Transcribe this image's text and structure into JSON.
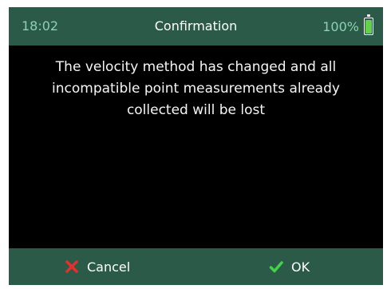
{
  "status": {
    "time": "18:02",
    "title": "Confirmation",
    "battery_percent_text": "100%",
    "battery_level": 1.0
  },
  "message": {
    "text": "The velocity method has changed and all incompatible point measurements already collected will be lost"
  },
  "footer": {
    "cancel_label": "Cancel",
    "ok_label": "OK"
  },
  "colors": {
    "header_bg": "#2b5a48",
    "footer_bg": "#2b5a48",
    "accent": "#8ed0b3",
    "cancel_icon": "#e4302c",
    "ok_icon": "#43d04a"
  },
  "icons": {
    "cancel": "x-icon",
    "ok": "check-icon",
    "battery": "battery-icon"
  }
}
